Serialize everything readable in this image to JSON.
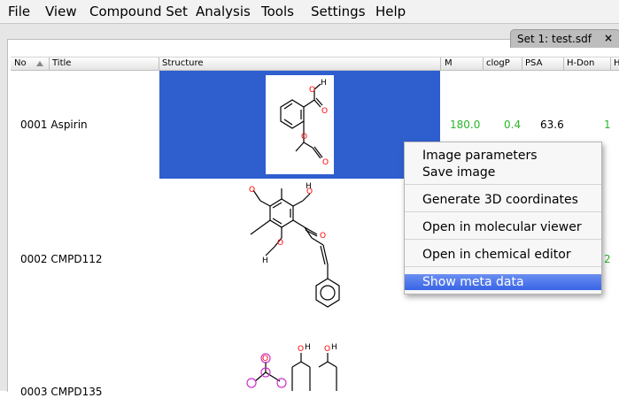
{
  "menubar": {
    "items": [
      "File",
      "View",
      "Compound Set",
      "Analysis",
      "Tools",
      "Settings",
      "Help"
    ]
  },
  "tab": {
    "label": "Set 1: test.sdf",
    "close": "×"
  },
  "table": {
    "headers": [
      "No",
      "Title",
      "Structure",
      "M",
      "clogP",
      "PSA",
      "H-Don",
      "H"
    ],
    "rows": [
      {
        "no_title": "0001 Aspirin",
        "mw": "180.0",
        "clogp": "0.4",
        "psa": "63.6",
        "hdon": "1"
      },
      {
        "no_title": "0002 CMPD112",
        "hdon": "2"
      },
      {
        "no_title": "0003 CMPD135"
      }
    ]
  },
  "context_menu": {
    "items": [
      "Image parameters",
      "Save image",
      "Generate 3D coordinates",
      "Open in molecular viewer",
      "Open in chemical editor",
      "Show meta data"
    ],
    "active_index": 5
  },
  "colors": {
    "selection": "#2f5fcf",
    "green_value": "#2bb52b",
    "menu_highlight": "#3864e6",
    "atom_O": "#ff0000",
    "atom_highlight": "#cc33cc"
  }
}
